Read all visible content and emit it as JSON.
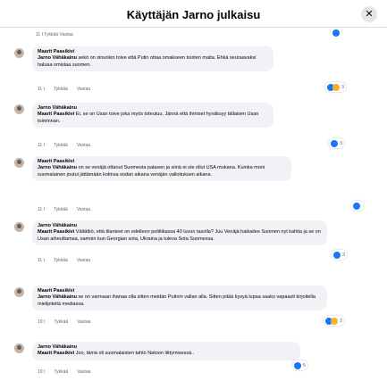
{
  "header": {
    "title": "Käyttäjän Jarno julkaisu",
    "close_icon": "close-icon"
  },
  "top_actions": "11 t   Tykkää   Vastaa",
  "comments": [
    {
      "author": "Maarit Paasikivi",
      "mention": "Jarno Vähäkainu",
      "text": " sekö on sinunkin toive että Putin ottaa omakseen toisten maita. Ehkä seuraavaksi haluaa omistaa suomen.",
      "time": "11 t",
      "like": "Tykkää",
      "reply": "Vastaa",
      "reaction_count": "3"
    },
    {
      "author": "Jarno Vähäkainu",
      "mention": "Maarit Paasikivi",
      "text": " Ei, se on Usan toive joka myös toteutuu. Jännä että ihmiset hyväksyy tällaisen Usan toiminnan.",
      "time": "11 t",
      "like": "Tykkää",
      "reply": "Vastaa",
      "reaction_count": "3"
    },
    {
      "author": "Maarit Paasikivi",
      "mention": "Jarno Vähäkainu",
      "text": " on se venäjä ottanut Suomesta palasen ja siinä ei ole ollut USA mukana. Kuinka moni suomalainen joutui jättämään kotinsa sodan aikana venäjän valloituksen aikana.",
      "time": "11 t",
      "like": "Tykkää",
      "reply": "Vastaa",
      "reaction_count": ""
    },
    {
      "author": "Jarno Vähäkainu",
      "mention": "Maarit Paasikivi",
      "text": " Väitätkö, että tilanteet on edelleen politiikassa 40 luvun tasolla? Juu Venäjä haikailee Suomen nyt kahtia ja se on Usan aiheuttamaa, samoin kun Georgian sota, Ukraina ja tuleva Sota Suomessa.",
      "time": "11 t",
      "like": "Tykkää",
      "reply": "Vastaa",
      "reaction_count": "3"
    },
    {
      "author": "Maarit Paasikivi",
      "mention": "Jarno Vähäkainu",
      "text": " se on varmaan ihanaa olla sitten meidän Putinin vallan alla. Sitten pitää kysyä lupaa saako vapaasti kirjoitella mielipiteitä mediassa.",
      "time": "10 t",
      "like": "Tykkää",
      "reply": "Vastaa",
      "reaction_count": "2"
    },
    {
      "author": "Jarno Vähäkainu",
      "mention": "Maarit Paasikivi",
      "text": " Joo, tämä oli suomalaisten tahto Natoon liittymisessä..",
      "time": "10 t",
      "like": "Tykkää",
      "reply": "Vastaa",
      "reaction_count": "5"
    }
  ],
  "colors": {
    "accent": "#1877f2",
    "bubble": "#f0f2f5",
    "muted": "#65676b"
  }
}
